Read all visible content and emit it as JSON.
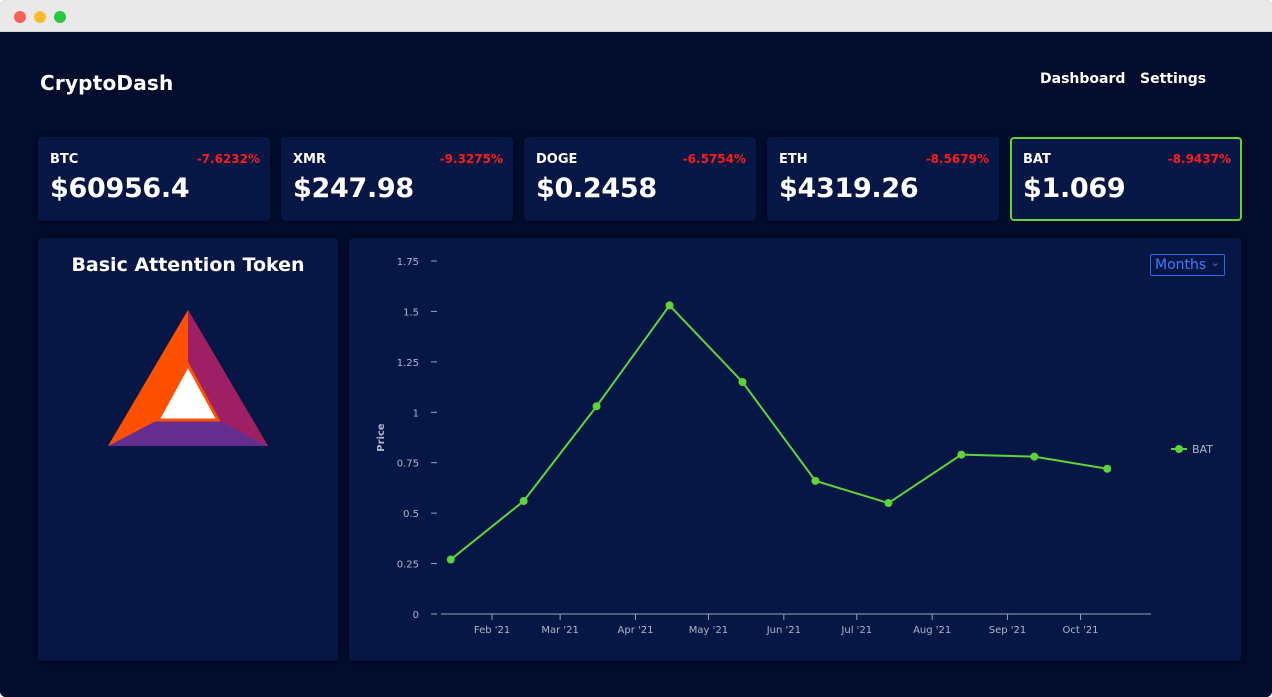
{
  "window": {
    "controls": [
      "close",
      "minimize",
      "maximize"
    ]
  },
  "header": {
    "brand": "CryptoDash",
    "nav": [
      {
        "label": "Dashboard"
      },
      {
        "label": "Settings"
      }
    ]
  },
  "tickers": [
    {
      "symbol": "BTC",
      "change": "-7.6232%",
      "price": "$60956.4",
      "active": false
    },
    {
      "symbol": "XMR",
      "change": "-9.3275%",
      "price": "$247.98",
      "active": false
    },
    {
      "symbol": "DOGE",
      "change": "-6.5754%",
      "price": "$0.2458",
      "active": false
    },
    {
      "symbol": "ETH",
      "change": "-8.5679%",
      "price": "$4319.26",
      "active": false
    },
    {
      "symbol": "BAT",
      "change": "-8.9437%",
      "price": "$1.069",
      "active": true
    }
  ],
  "selected": {
    "name": "Basic Attention Token",
    "logo_icon": "bat-logo-icon"
  },
  "range_select": {
    "value": "Months",
    "icon": "chevron-down-icon"
  },
  "colors": {
    "background": "#020c2c",
    "panel": "#071745",
    "negative": "#ff1a1a",
    "series": "#5fd33a",
    "select": "#3d7bff"
  },
  "chart_data": {
    "type": "line",
    "ylabel": "Price",
    "xlabel": "",
    "ylim": [
      0,
      1.75
    ],
    "yticks": [
      0,
      0.25,
      0.5,
      0.75,
      1,
      1.25,
      1.5,
      1.75
    ],
    "ytick_labels": [
      "0",
      "0.25",
      "0.5",
      "0.75",
      "1",
      "1.25",
      "1.5",
      "1.75"
    ],
    "xlim": [
      "2021-01-11",
      "2021-10-30"
    ],
    "xticks": [
      "2021-02-01",
      "2021-03-01",
      "2021-04-01",
      "2021-05-01",
      "2021-06-01",
      "2021-07-01",
      "2021-08-01",
      "2021-09-01",
      "2021-10-01"
    ],
    "xtick_labels": [
      "Feb '21",
      "Mar '21",
      "Apr '21",
      "May '21",
      "Jun '21",
      "Jul '21",
      "Aug '21",
      "Sep '21",
      "Oct '21"
    ],
    "legend": "right",
    "grid": false,
    "series": [
      {
        "name": "BAT",
        "x": [
          "2021-01-15",
          "2021-02-14",
          "2021-03-16",
          "2021-04-15",
          "2021-05-15",
          "2021-06-14",
          "2021-07-14",
          "2021-08-13",
          "2021-09-12",
          "2021-10-12"
        ],
        "values": [
          0.27,
          0.56,
          1.03,
          1.53,
          1.15,
          0.66,
          0.55,
          0.79,
          0.78,
          0.72
        ]
      }
    ]
  }
}
